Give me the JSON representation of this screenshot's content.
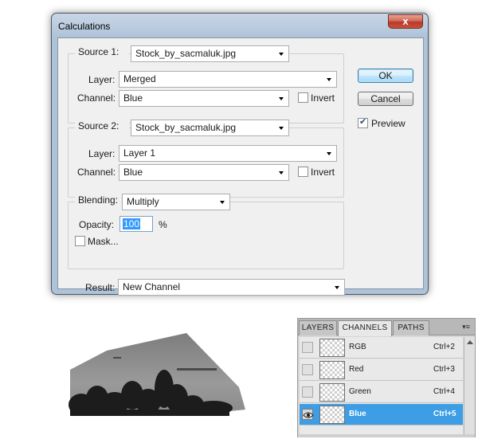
{
  "dialog": {
    "title": "Calculations",
    "close_glyph": "x",
    "source1": {
      "label": "Source 1:",
      "value": "Stock_by_sacmaluk.jpg",
      "layer_label": "Layer:",
      "layer_value": "Merged",
      "channel_label": "Channel:",
      "channel_value": "Blue",
      "invert_label": "Invert",
      "invert_checked": false
    },
    "source2": {
      "label": "Source 2:",
      "value": "Stock_by_sacmaluk.jpg",
      "layer_label": "Layer:",
      "layer_value": "Layer 1",
      "channel_label": "Channel:",
      "channel_value": "Blue",
      "invert_label": "Invert",
      "invert_checked": false
    },
    "blending": {
      "label": "Blending:",
      "value": "Multiply",
      "opacity_label": "Opacity:",
      "opacity_value": "100",
      "opacity_unit": "%",
      "mask_label": "Mask...",
      "mask_checked": false
    },
    "result": {
      "label": "Result:",
      "value": "New Channel"
    },
    "ok_label": "OK",
    "cancel_label": "Cancel",
    "preview_label": "Preview",
    "preview_checked": true
  },
  "channels_panel": {
    "tabs": [
      "LAYERS",
      "CHANNELS",
      "PATHS"
    ],
    "active_tab": "CHANNELS",
    "menu_icon": "panel-menu-icon",
    "rows": [
      {
        "name": "RGB",
        "shortcut": "Ctrl+2",
        "visible": false,
        "selected": false
      },
      {
        "name": "Red",
        "shortcut": "Ctrl+3",
        "visible": false,
        "selected": false
      },
      {
        "name": "Green",
        "shortcut": "Ctrl+4",
        "visible": false,
        "selected": false
      },
      {
        "name": "Blue",
        "shortcut": "Ctrl+5",
        "visible": true,
        "selected": true
      }
    ]
  },
  "colors": {
    "selection_blue": "#3d9ee6",
    "dialog_frame": "#aec2d8",
    "close_red": "#c9523c"
  }
}
